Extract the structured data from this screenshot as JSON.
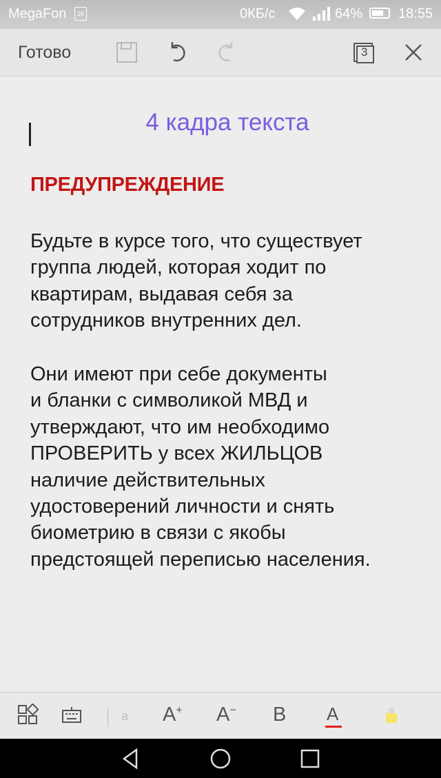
{
  "status_bar": {
    "carrier": "MegaFon",
    "sim_badge": "26",
    "network_speed": "0КБ/с",
    "battery_percent": "64%",
    "time": "18:55"
  },
  "toolbar": {
    "done_label": "Готово",
    "pages_count": "3",
    "icons": [
      "save-icon",
      "undo-icon",
      "redo-icon",
      "pages-icon",
      "close-icon"
    ]
  },
  "note": {
    "title": "4 кадра текста",
    "heading": "ПРЕДУПРЕЖДЕНИЕ",
    "paragraph1": "Будьте в курсе того, что существует\nгруппа людей, которая ходит по\nквартирам, выдавая себя за\nсотрудников внутренних дел.",
    "paragraph2": "Они имеют при себе документы\nи бланки с символикой МВД и\nутверждают, что им необходимо\nПРОВЕРИТЬ у всех ЖИЛЬЦОВ\nналичие действительных\nудостоверений личности и снять\nбиометрию в связи с якобы\nпредстоящей переписью населения.",
    "title_color": "#7a5de0",
    "heading_color": "#c41414"
  },
  "format_bar": {
    "small_text_label": "a",
    "bold_label": "B",
    "font_color_label": "A",
    "font_color_underline": "#e02020",
    "highlight_color": "#f6e36a"
  }
}
